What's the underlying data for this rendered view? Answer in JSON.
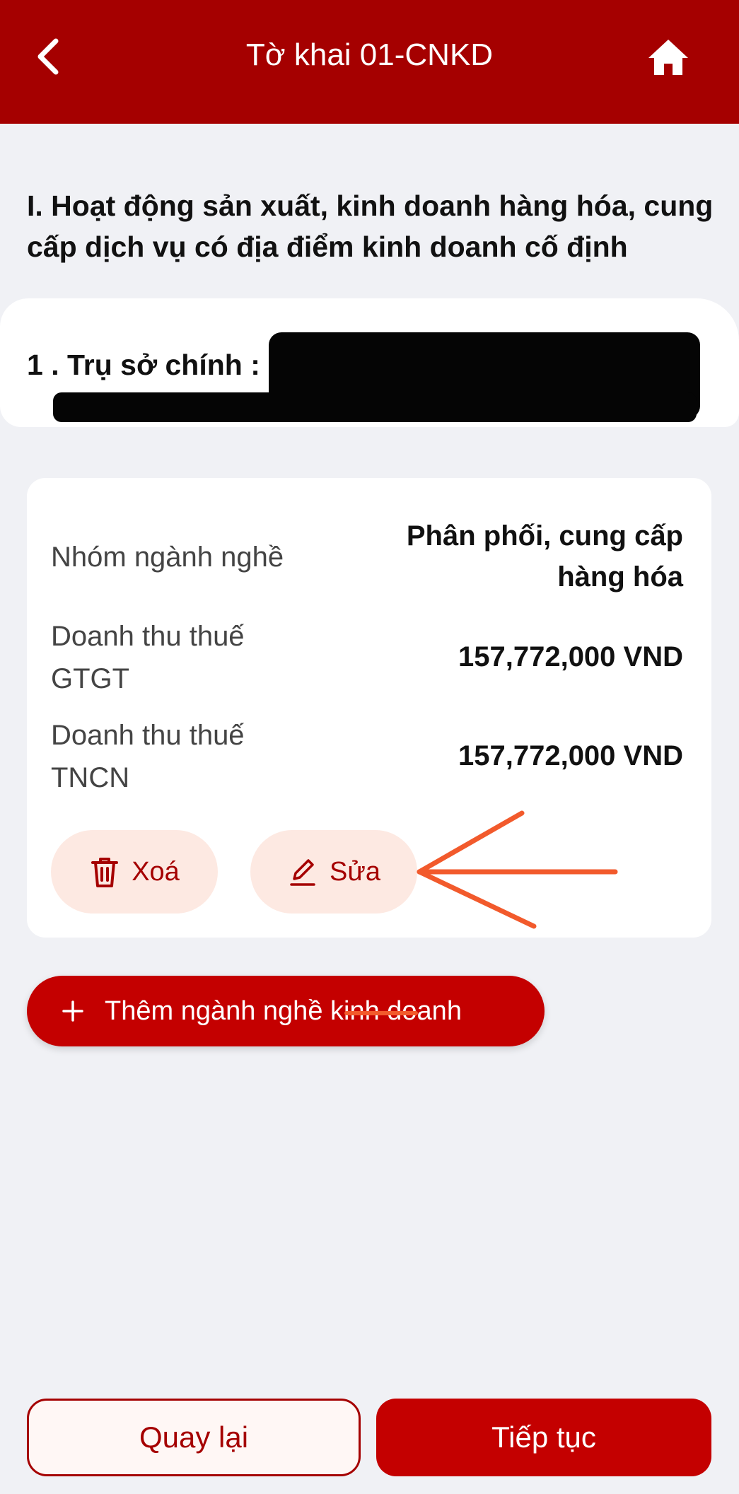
{
  "header": {
    "title": "Tờ khai 01-CNKD",
    "back_icon": "chevron-left-icon",
    "home_icon": "home-icon",
    "background_color": "#a50000"
  },
  "section": {
    "heading": "I. Hoạt động sản xuất, kinh doanh hàng hóa, cung cấp dịch vụ có địa điểm kinh doanh cố định",
    "location_label": "1 . Trụ sở chính :"
  },
  "business_card": {
    "rows": [
      {
        "label": "Nhóm ngành nghề",
        "value": "Phân phối, cung cấp hàng hóa"
      },
      {
        "label": "Doanh thu thuế GTGT",
        "value": "157,772,000 VND"
      },
      {
        "label": "Doanh thu thuế TNCN",
        "value": "157,772,000 VND"
      }
    ],
    "delete_label": "Xoá",
    "delete_icon": "trash-icon",
    "edit_label": "Sửa",
    "edit_icon": "pencil-icon"
  },
  "add_business": {
    "label": "Thêm ngành nghề kinh doanh",
    "icon": "plus-icon"
  },
  "footer": {
    "back_label": "Quay lại",
    "next_label": "Tiếp tục"
  },
  "colors": {
    "brand": "#a50000",
    "primary_button": "#c40000",
    "pill_background": "#fde9e2",
    "annotation_arrow": "#f25a2c"
  }
}
